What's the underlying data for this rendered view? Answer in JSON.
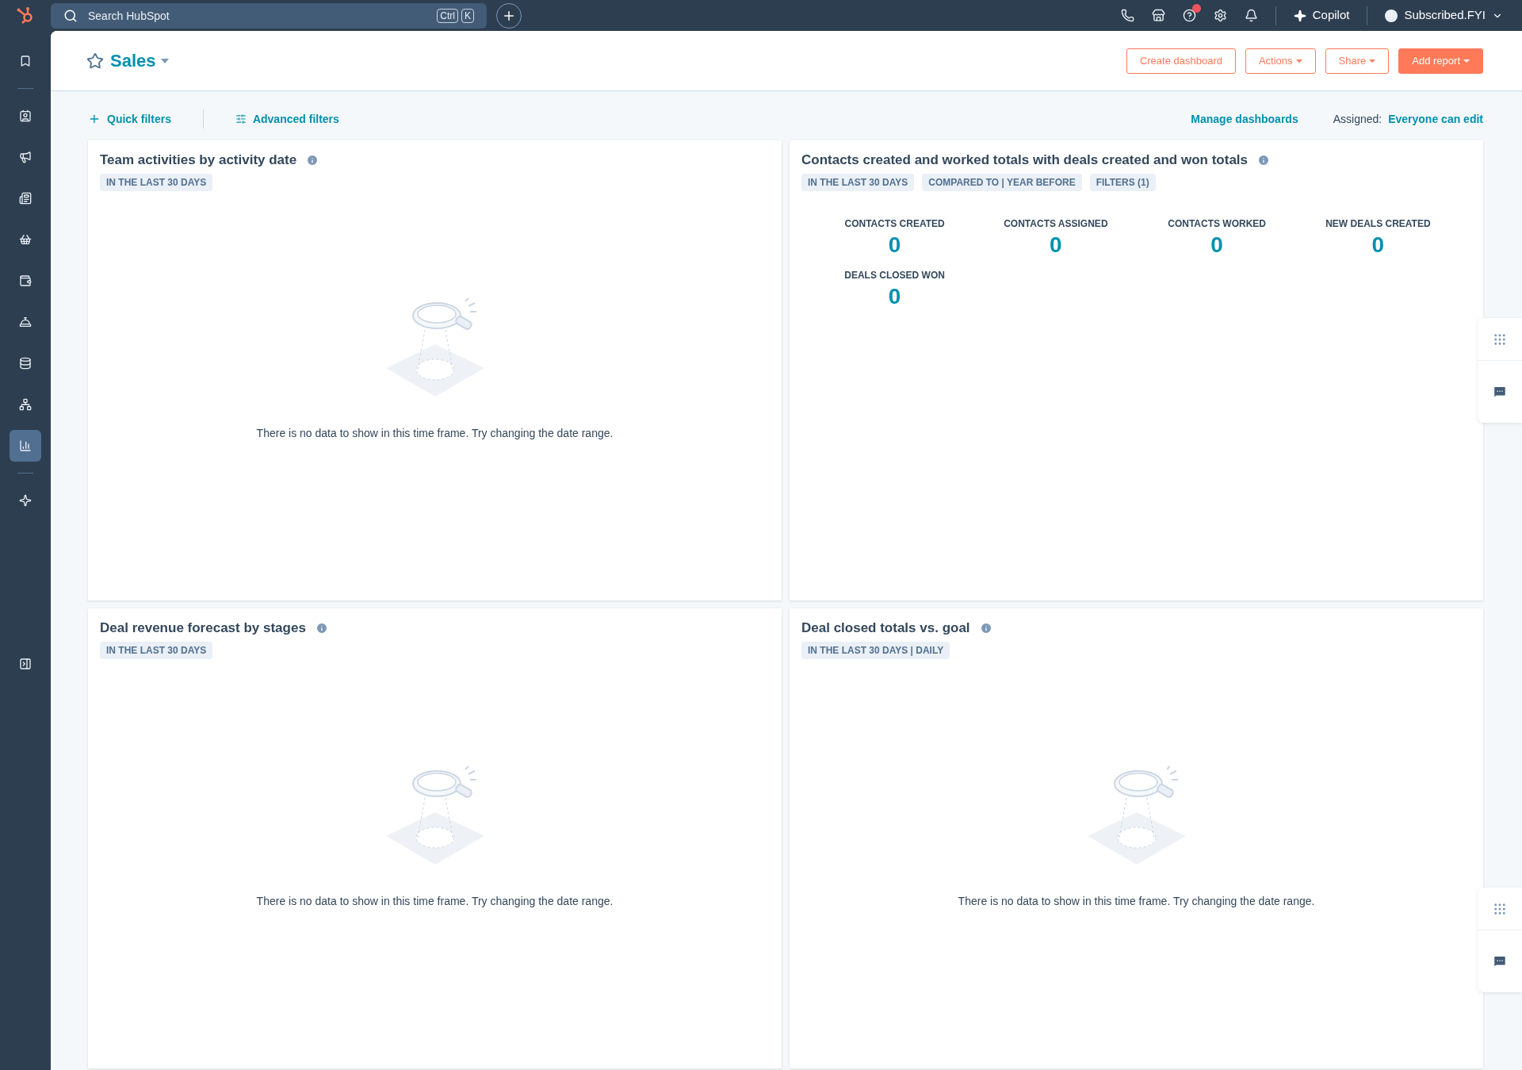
{
  "topbar": {
    "search": {
      "placeholder": "Search HubSpot",
      "keys": [
        "Ctrl",
        "K"
      ]
    },
    "help_badge": true,
    "copilot": "Copilot",
    "account": "Subscribed.FYI"
  },
  "sidebar": {
    "items": [
      {
        "selected": false
      },
      {
        "selected": false
      },
      {
        "selected": false
      },
      {
        "selected": false
      },
      {
        "selected": false
      },
      {
        "selected": false
      },
      {
        "selected": false
      },
      {
        "selected": false
      },
      {
        "selected": false
      },
      {
        "selected": true
      },
      {
        "selected": false
      }
    ]
  },
  "header": {
    "title": "Sales",
    "favorite": false,
    "buttons": [
      {
        "label": "Create dashboard",
        "kind": "outline",
        "caret": false
      },
      {
        "label": "Actions",
        "kind": "outline",
        "caret": true
      },
      {
        "label": "Share",
        "kind": "outline",
        "caret": true
      },
      {
        "label": "Add report",
        "kind": "primary",
        "caret": true
      }
    ]
  },
  "filters": {
    "quick": "Quick filters",
    "advanced": "Advanced filters",
    "manage": "Manage dashboards",
    "assigned_label": "Assigned:",
    "assigned_value": "Everyone can edit"
  },
  "cards": [
    {
      "title": "Team activities by activity date",
      "tags": [
        "IN THE LAST 30 DAYS"
      ],
      "kind": "empty",
      "message": "There is no data to show in this time frame. Try changing the date range."
    },
    {
      "title": "Contacts created and worked totals with deals created and won totals",
      "tags": [
        "IN THE LAST 30 DAYS",
        "COMPARED TO | YEAR BEFORE",
        "FILTERS (1)"
      ],
      "kind": "kpis",
      "metrics": [
        {
          "label": "CONTACTS CREATED",
          "value": "0"
        },
        {
          "label": "CONTACTS ASSIGNED",
          "value": "0"
        },
        {
          "label": "CONTACTS WORKED",
          "value": "0"
        },
        {
          "label": "NEW DEALS CREATED",
          "value": "0"
        },
        {
          "label": "DEALS CLOSED WON",
          "value": "0"
        }
      ]
    },
    {
      "title": "Deal revenue forecast by stages",
      "tags": [
        "IN THE LAST 30 DAYS"
      ],
      "kind": "empty",
      "message": "There is no data to show in this time frame. Try changing the date range."
    },
    {
      "title": "Deal closed totals vs. goal",
      "tags": [
        "IN THE LAST 30 DAYS | DAILY"
      ],
      "kind": "empty",
      "message": "There is no data to show in this time frame. Try changing the date range."
    }
  ]
}
